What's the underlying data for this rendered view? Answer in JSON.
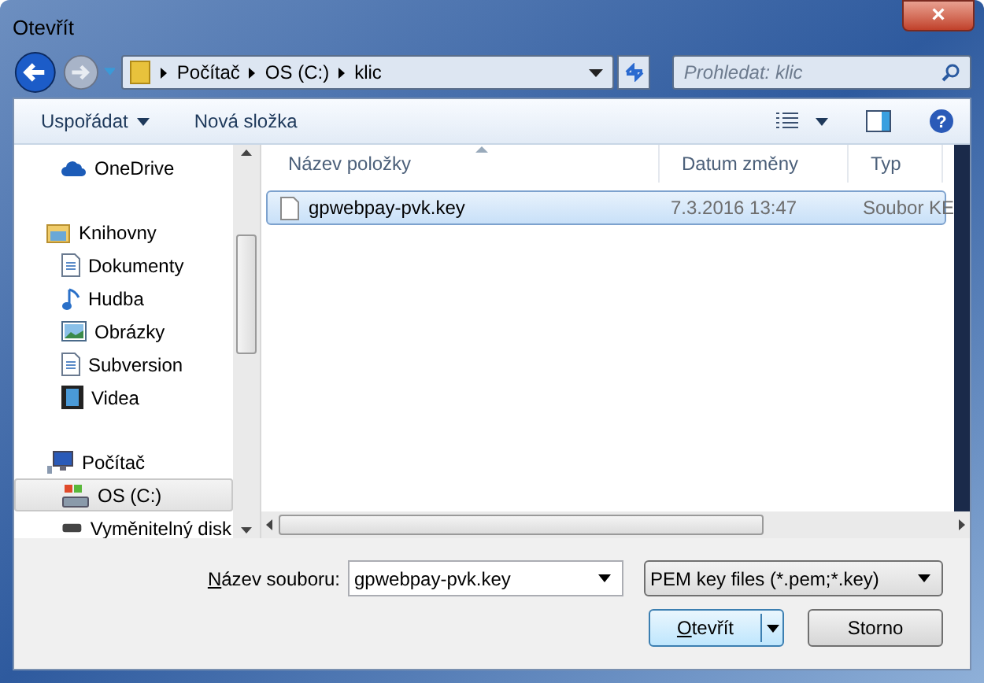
{
  "window": {
    "title": "Otevřít",
    "close": "×"
  },
  "address": {
    "crumbs": [
      "Počítač",
      "OS (C:)",
      "klic"
    ]
  },
  "search": {
    "placeholder": "Prohledat: klic"
  },
  "toolbar": {
    "organize": "Uspořádat",
    "new_folder": "Nová složka",
    "help": "?"
  },
  "sidebar": {
    "items": [
      {
        "label": "OneDrive",
        "kind": "cloud",
        "selected": false
      },
      {
        "label": "Knihovny",
        "kind": "library",
        "selected": false,
        "children": [
          {
            "label": "Dokumenty",
            "kind": "document",
            "selected": false
          },
          {
            "label": "Hudba",
            "kind": "music",
            "selected": false
          },
          {
            "label": "Obrázky",
            "kind": "picture",
            "selected": false
          },
          {
            "label": "Subversion",
            "kind": "document",
            "selected": false
          },
          {
            "label": "Videa",
            "kind": "video",
            "selected": false
          }
        ]
      },
      {
        "label": "Počítač",
        "kind": "computer",
        "selected": false,
        "children": [
          {
            "label": "OS (C:)",
            "kind": "drive",
            "selected": true
          },
          {
            "label": "Vyměnitelný disk",
            "kind": "removable",
            "selected": false
          }
        ]
      }
    ]
  },
  "table": {
    "columns": [
      "Název položky",
      "Datum změny",
      "Typ"
    ],
    "rows": [
      {
        "name": "gpwebpay-pvk.key",
        "date": "7.3.2016 13:47",
        "type": "Soubor KE",
        "selected": true
      }
    ]
  },
  "footer": {
    "filename_label": "Název souboru:",
    "filename": "gpwebpay-pvk.key",
    "filter": "PEM key files (*.pem;*.key)",
    "open": "Otevřít",
    "cancel": "Storno"
  }
}
